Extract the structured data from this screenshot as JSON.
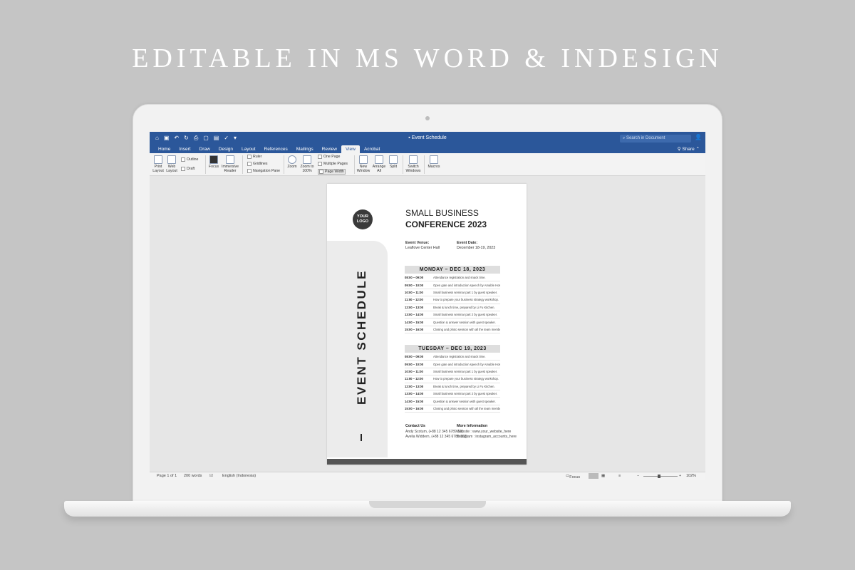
{
  "headline": "EDITABLE IN MS WORD & INDESIGN",
  "titlebar": {
    "title": "Event Schedule",
    "search_placeholder": "Search in Document",
    "qat_icons": [
      "home-icon",
      "save-icon",
      "undo-icon",
      "redo-icon",
      "print-icon",
      "file-icon",
      "chart-icon",
      "check-icon",
      "more-icon"
    ]
  },
  "tabs": [
    "Home",
    "Insert",
    "Draw",
    "Design",
    "Layout",
    "References",
    "Mailings",
    "Review",
    "View",
    "Acrobat"
  ],
  "active_tab": "View",
  "share_label": "Share",
  "ribbon": {
    "print_layout": "Print Layout",
    "web_layout": "Web Layout",
    "outline": "Outline",
    "draft": "Draft",
    "focus": "Focus",
    "immersive_reader": "Immersive Reader",
    "ruler": "Ruler",
    "gridlines": "Gridlines",
    "navigation_pane": "Navigation Pane",
    "zoom": "Zoom",
    "zoom_100": "Zoom to 100%",
    "one_page": "One Page",
    "multiple_pages": "Multiple Pages",
    "page_width": "Page Width",
    "new_window": "New Window",
    "arrange_all": "Arrange All",
    "split": "Split",
    "switch_windows": "Switch Windows",
    "macros": "Macros"
  },
  "status": {
    "page": "Page 1 of 1",
    "words": "200 words",
    "language": "English (Indonesia)",
    "focus": "Focus",
    "zoom": "102%"
  },
  "doc": {
    "logo_line1": "YOUR",
    "logo_line2": "LOGO",
    "side_title": "EVENT SCHEDULE",
    "title_line1": "SMALL BUSINESS",
    "title_line2": "CONFERENCE 2023",
    "venue_label": "Event Venue:",
    "venue": "Leaflove Center Hall",
    "date_label": "Event Date:",
    "date": "December 18-19, 2023",
    "day1": "MONDAY – DEC 18, 2023",
    "day2": "TUESDAY – DEC 19, 2023",
    "schedule1": [
      {
        "time": "08:00 – 09:00",
        "desc": "Attendance registration and snack time."
      },
      {
        "time": "09:00 – 10:00",
        "desc": "Open gate and introduction speech by Amable Hosse."
      },
      {
        "time": "10:00 – 11:00",
        "desc": "Small business seminar part 1 by guest speaker."
      },
      {
        "time": "11:00 – 12:00",
        "desc": "How to prepare your business strategy workshop."
      },
      {
        "time": "12:00 – 13:00",
        "desc": "Break & lunch time, prepared by Li Fu Kitchen."
      },
      {
        "time": "13:00 – 14:00",
        "desc": "Small business seminar part 2 by guest speaker."
      },
      {
        "time": "14:00 – 15:00",
        "desc": "Question & answer session with guest speaker."
      },
      {
        "time": "15:00 – 16:00",
        "desc": "Closing and photo session with all the team member."
      }
    ],
    "schedule2": [
      {
        "time": "08:00 – 09:00",
        "desc": "Attendance registration and snack time."
      },
      {
        "time": "09:00 – 10:00",
        "desc": "Open gate and introduction speech by Amable Hosse."
      },
      {
        "time": "10:00 – 11:00",
        "desc": "Small business seminar part 1 by guest speaker."
      },
      {
        "time": "11:00 – 12:00",
        "desc": "How to prepare your business strategy workshop."
      },
      {
        "time": "12:00 – 13:00",
        "desc": "Break & lunch time, prepared by Li Fu Kitchen."
      },
      {
        "time": "13:00 – 14:00",
        "desc": "Small business seminar part 2 by guest speaker."
      },
      {
        "time": "14:00 – 15:00",
        "desc": "Question & answer session with guest speaker."
      },
      {
        "time": "15:00 – 16:00",
        "desc": "Closing and photo session with all the team member."
      }
    ],
    "contact_label": "Contact Us",
    "contact1": "Andy Scotum, (+88 12 345 6789 10)",
    "contact2": "Avelia Widdern, (+88 12 345 6789 102)",
    "more_label": "More Information",
    "website": "Website : www.your_website_here",
    "instagram": "Instagram : instagram_accounts_here"
  },
  "colors": {
    "word_blue": "#2b579a",
    "background": "#c5c5c5"
  }
}
